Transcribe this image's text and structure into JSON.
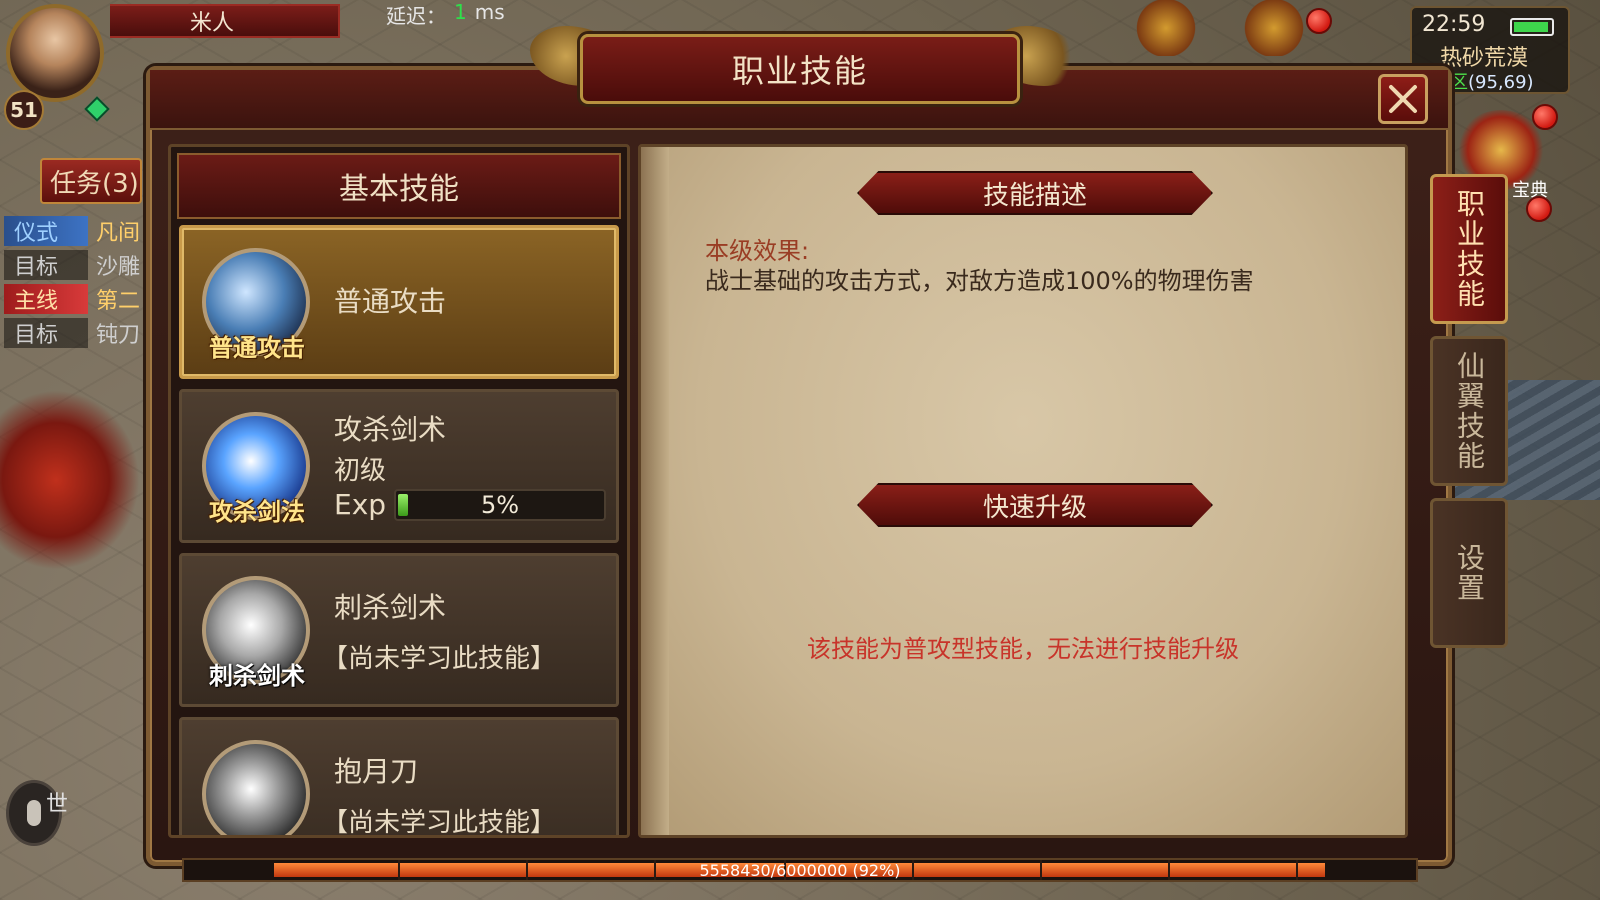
{
  "hud": {
    "player_name": "米人",
    "level": "51",
    "latency_label": "延迟：",
    "latency_value": "1",
    "latency_unit": "ms",
    "quest_tab": "任务(3)",
    "quests": [
      {
        "tag": "仪式",
        "tag_style": "blue",
        "text": "凡间",
        "text_style": "gold"
      },
      {
        "tag": "目标",
        "tag_style": "plain",
        "text": "沙雕",
        "text_style": "grey"
      },
      {
        "tag": "主线",
        "tag_style": "red",
        "text": "第二",
        "text_style": "gold"
      },
      {
        "tag": "目标",
        "tag_style": "plain",
        "text": "钝刀",
        "text_style": "grey"
      }
    ],
    "world_chat_label": "世",
    "clock": "22:59",
    "map_name": "热砂荒漠",
    "zone": "全区",
    "coords": "(95,69)",
    "book_label": "宝典"
  },
  "dialog": {
    "title": "职业技能",
    "close_icon": "close-icon",
    "skill_list_header": "基本技能",
    "skills": [
      {
        "icon_caption": "普通攻击",
        "name": "普通攻击",
        "selected": true
      },
      {
        "icon_caption": "攻杀剑法",
        "name": "攻杀剑术",
        "rank": "初级",
        "exp_label": "Exp",
        "exp_percent_text": "5%",
        "exp_fraction": 0.05
      },
      {
        "icon_caption": "刺杀剑术",
        "name": "刺杀剑术",
        "status": "【尚未学习此技能】"
      },
      {
        "icon_caption": "",
        "name": "抱月刀",
        "status": "【尚未学习此技能】"
      }
    ],
    "description": {
      "section_title": "技能描述",
      "effect_label": "本级效果:",
      "effect_text": "战士基础的攻击方式，对敌方造成100%的物理伤害",
      "upgrade_title": "快速升级",
      "upgrade_warning": "该技能为普攻型技能，无法进行技能升级"
    }
  },
  "side_tabs": [
    {
      "label": "职业技能",
      "active": true
    },
    {
      "label": "仙翼技能",
      "active": false
    },
    {
      "label": "设置",
      "active": false
    }
  ],
  "exp_bar": {
    "text": "5558430/6000000 (92%)",
    "fraction": 0.92
  },
  "colors": {
    "accent_red": "#8a1f18",
    "gold_border": "#c89a4a",
    "parchment": "#d8c7a7",
    "warning_red": "#c8342a"
  }
}
